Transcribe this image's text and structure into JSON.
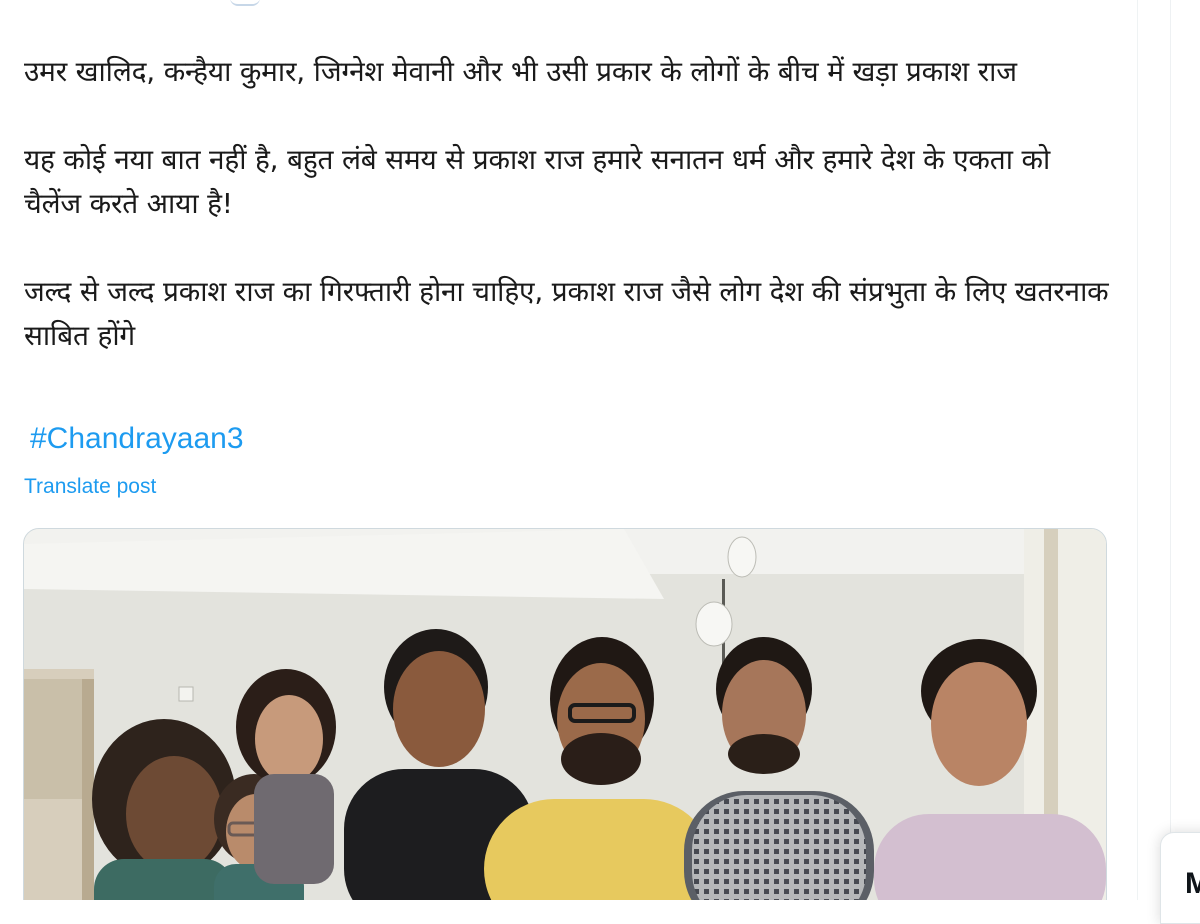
{
  "tweet": {
    "paragraphs": [
      "उमर खालिद, कन्हैया कुमार, जिग्नेश मेवानी और भी उसी प्रकार के लोगों के बीच में खड़ा प्रकाश राज",
      "यह कोई नया बात नहीं है, बहुत लंबे समय से प्रकाश राज हमारे सनातन धर्म और हमारे देश के एकता को चैलेंज करते आया है!",
      "जल्द से जल्द प्रकाश राज का गिरफ्तारी होना चाहिए, प्रकाश राज जैसे लोग देश की संप्रभुता के लिए खतरनाक साबित होंगे"
    ],
    "hashtag": "#Chandrayaan3",
    "translate_label": "Translate post"
  },
  "media": {
    "kind": "photo",
    "people_count": 7
  },
  "right_rail": {
    "card_letter": "M"
  },
  "colors": {
    "link": "#1d9bf0",
    "text": "#1a1a1a",
    "border": "#cfd9de"
  }
}
